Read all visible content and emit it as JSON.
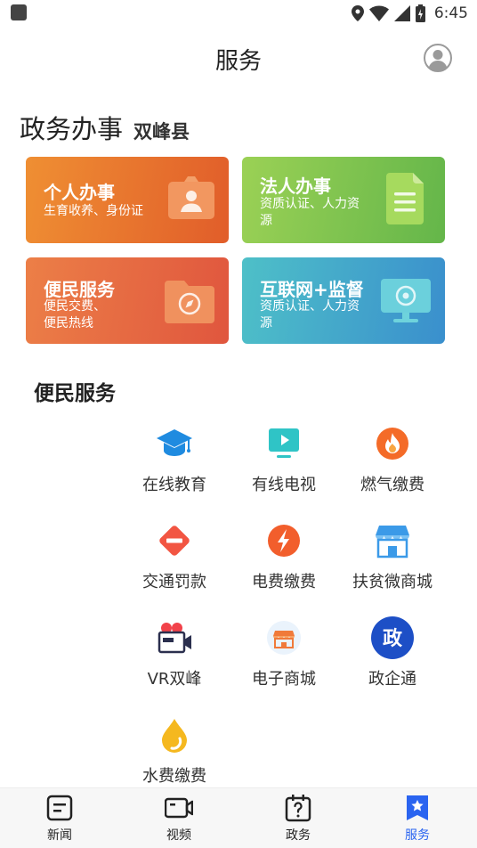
{
  "status_bar": {
    "time": "6:45"
  },
  "header": {
    "title": "服务"
  },
  "gov_section": {
    "title": "政务办事",
    "county": "双峰县"
  },
  "cards": {
    "personal": {
      "title": "个人办事",
      "subtitle": "生育收养、身份证"
    },
    "legal": {
      "title": "法人办事",
      "subtitle": "资质认证、人力资源"
    },
    "convenience": {
      "title": "便民服务",
      "subtitle": "便民交费、便民热线"
    },
    "internet": {
      "title": "互联网+监督",
      "subtitle": "资质认证、人力资源"
    }
  },
  "services_section": {
    "title": "便民服务",
    "items": [
      {
        "label": "在线教育",
        "icon": "graduation-cap-icon"
      },
      {
        "label": "有线电视",
        "icon": "tv-icon"
      },
      {
        "label": "燃气缴费",
        "icon": "flame-icon"
      },
      {
        "label": "交通罚款",
        "icon": "no-entry-icon"
      },
      {
        "label": "电费缴费",
        "icon": "lightning-icon"
      },
      {
        "label": "扶贫微商城",
        "icon": "store-icon"
      },
      {
        "label": "VR双峰",
        "icon": "video-camera-icon"
      },
      {
        "label": "电子商城",
        "icon": "shop-icon"
      },
      {
        "label": "政企通",
        "icon": "zheng-badge-icon",
        "badge_text": "政"
      },
      {
        "label": "水费缴费",
        "icon": "water-drop-icon"
      }
    ]
  },
  "bottom_nav": {
    "items": [
      {
        "label": "新闻",
        "icon": "news-icon"
      },
      {
        "label": "视频",
        "icon": "video-icon"
      },
      {
        "label": "政务",
        "icon": "calendar-question-icon"
      },
      {
        "label": "服务",
        "icon": "star-bookmark-icon",
        "active": true
      }
    ]
  },
  "colors": {
    "accent": "#2a64f0",
    "personal": "#e8742f",
    "legal": "#7cc34f",
    "convenience": "#e66a42",
    "internet": "#44a6cb"
  }
}
